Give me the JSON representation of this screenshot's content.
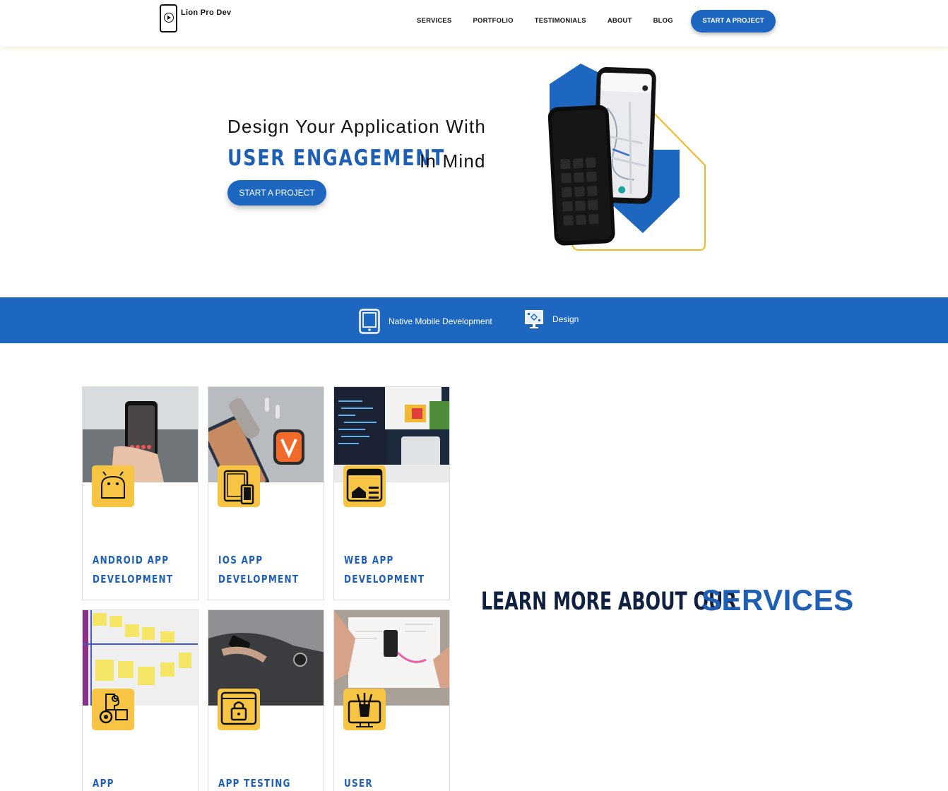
{
  "header": {
    "brand": "Lion Pro Dev",
    "nav": [
      "SERVICES",
      "PORTFOLIO",
      "TESTIMONIALS",
      "ABOUT",
      "BLOG"
    ],
    "cta": "START A PROJECT"
  },
  "hero": {
    "line1": "Design Your Application With",
    "accent": "USER ENGAGEMENT",
    "rest": "In Mind",
    "button": "START A PROJECT"
  },
  "band": {
    "items": [
      {
        "label": "Native Mobile Development",
        "icon": "tablet-icon"
      },
      {
        "label": "Design",
        "icon": "design-monitor-icon"
      }
    ]
  },
  "cards": [
    {
      "title": "ANDROID APP\nDEVELOPMENT",
      "icon": "android-icon"
    },
    {
      "title": "IOS APP\nDEVELOPMENT",
      "icon": "ios-devices-icon"
    },
    {
      "title": "WEB APP\nDEVELOPMENT",
      "icon": "web-app-icon"
    },
    {
      "title": "APP STRATEGY",
      "icon": "strategy-puzzle-icon"
    },
    {
      "title": "APP TESTING",
      "icon": "testing-lock-icon"
    },
    {
      "title": "USER EXPERIENCE",
      "icon": "design-tools-icon"
    }
  ],
  "learn": {
    "prefix": "LEARN MORE ABOUT OUR",
    "highlight": "SERVICES"
  },
  "colors": {
    "primary": "#1e67c0",
    "accent_text": "#1e5fb5",
    "badge": "#f7c543",
    "dark_heading": "#0f2040"
  }
}
